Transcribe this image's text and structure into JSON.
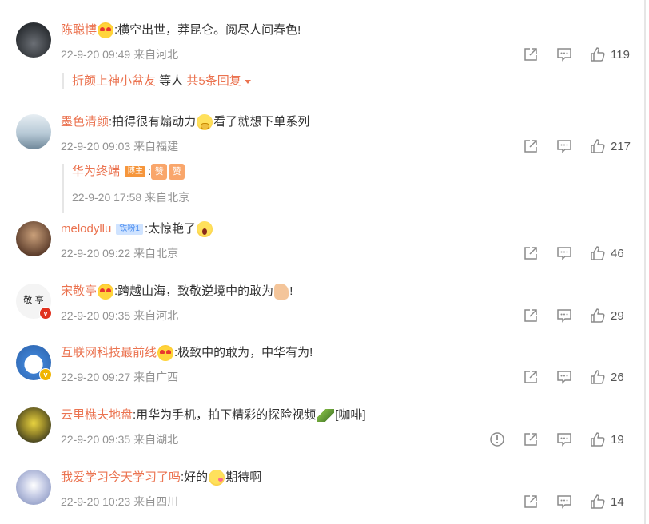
{
  "comments": [
    {
      "username": "陈聪博",
      "text_before": ":横空出世，莽昆仑。阅尽人间春色!",
      "text_after": "",
      "emoji": "love-eyes",
      "time": "22-9-20 09:49",
      "location": "来自河北",
      "likes": "119",
      "avatar_colors": [
        "#2b2f33",
        "#6b6f75"
      ],
      "reply_summary": {
        "user": "折颜上神小盆友",
        "middle": " 等人",
        "link": " 共5条回复"
      }
    },
    {
      "username": "墨色清颜",
      "text_before": ":拍得很有煽动力",
      "text_after": "看了就想下单系列",
      "emoji": "thinking",
      "time": "22-9-20 09:03",
      "location": "来自福建",
      "likes": "217",
      "avatar_colors": [
        "#9fb6c8",
        "#e7eef3"
      ],
      "sub_reply": {
        "user": "华为终端",
        "badge": "博主",
        "text": ":",
        "emoji_text": "赞",
        "time": "22-9-20 17:58",
        "location": "来自北京"
      }
    },
    {
      "username": "melodyllu",
      "badge": "铁粉1",
      "text_before": ":太惊艳了",
      "text_after": "",
      "emoji": "shocked",
      "time": "22-9-20 09:22",
      "location": "来自北京",
      "likes": "46",
      "avatar_colors": [
        "#5a3b2a",
        "#caa07a"
      ]
    },
    {
      "username": "宋敬亭",
      "text_before": ":跨越山海，致敬逆境中的敢为",
      "text_after": "!",
      "emoji": "thumbs-up",
      "time": "22-9-20 09:35",
      "location": "来自河北",
      "likes": "29",
      "avatar_text": "敬 亭",
      "avatar_colors": [
        "#f4f4f4",
        "#ffffff"
      ]
    },
    {
      "username": "互联网科技最前线",
      "text_before": ":极致中的敢为，中华有为!",
      "text_after": "",
      "emoji": "love-eyes",
      "time": "22-9-20 09:27",
      "location": "来自广西",
      "likes": "26",
      "avatar_colors": [
        "#3d7fd0",
        "#ffffff"
      ]
    },
    {
      "username": "云里樵夫地盘",
      "text_before": ":用华为手机，拍下精彩的探险视频",
      "text_after": "[咖啡]",
      "emoji": "leaf",
      "time": "22-9-20 09:35",
      "location": "来自湖北",
      "likes": "19",
      "avatar_colors": [
        "#3b3a1e",
        "#e8d340"
      ]
    },
    {
      "username": "我爱学习今天学习了吗",
      "text_before": ":好的",
      "text_after": "期待啊",
      "emoji": "kiss",
      "time": "22-9-20 10:23",
      "location": "来自四川",
      "likes": "14",
      "avatar_colors": [
        "#7a88b8",
        "#ffffff"
      ]
    }
  ],
  "colors": {
    "username": "#eb7350",
    "meta": "#939393",
    "icon": "#8a8a8a"
  }
}
